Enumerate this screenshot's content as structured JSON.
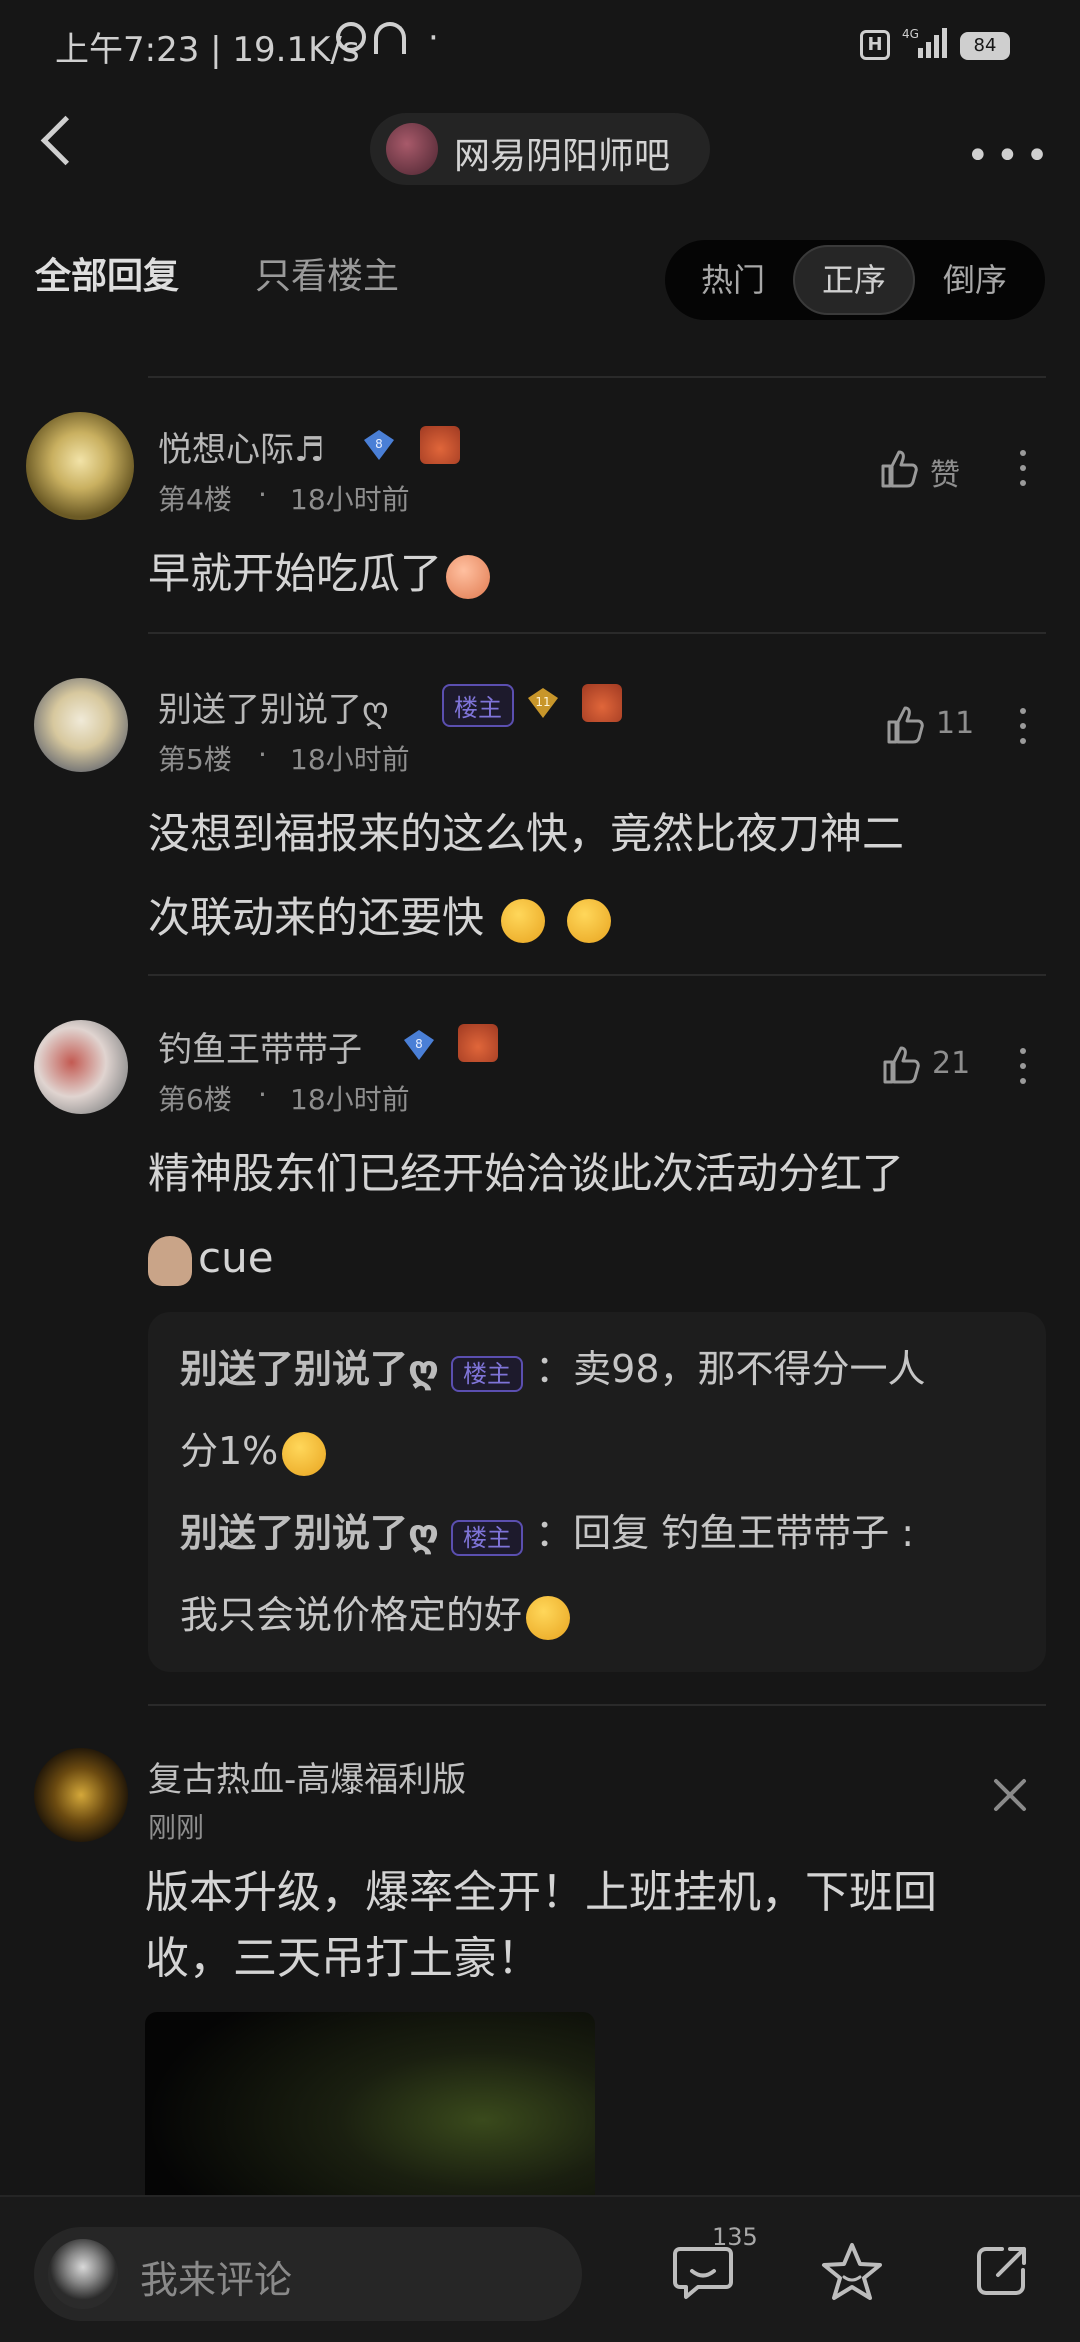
{
  "status_bar": {
    "time_speed": "上午7:23 | 19.1K/s",
    "dot": "·",
    "network": "4G",
    "battery": "84"
  },
  "nav": {
    "forum_name": "网易阴阳师吧"
  },
  "tabs": {
    "all_replies": "全部回复",
    "only_op": "只看楼主",
    "sort": [
      "热门",
      "正序",
      "倒序"
    ],
    "sort_selected": "正序"
  },
  "posts": [
    {
      "username": "悦想心际♬",
      "level": "8",
      "floor": "第4楼",
      "separator": "·",
      "time": "18小时前",
      "like_label": "赞",
      "content": "早就开始吃瓜了"
    },
    {
      "username": "别送了别说了ღ",
      "op_badge": "楼主",
      "level": "11",
      "floor": "第5楼",
      "separator": "·",
      "time": "18小时前",
      "likes": "11",
      "content_line1": "没想到福报来的这么快，竟然比夜刀神二",
      "content_line2": "次联动来的还要快"
    },
    {
      "username": "钓鱼王带带子",
      "level": "8",
      "floor": "第6楼",
      "separator": "·",
      "time": "18小时前",
      "likes": "21",
      "content_line1": "精神股东们已经开始洽谈此次活动分红了",
      "content_line2": "cue",
      "replies": [
        {
          "name": "别送了别说了ღ",
          "badge": "楼主",
          "text_line1": "：卖98，那不得分一人",
          "text_line2": "分1%"
        },
        {
          "name": "别送了别说了ღ",
          "badge": "楼主",
          "text_line1": "：回复 钓鱼王带带子 :",
          "text_line2": "我只会说价格定的好"
        }
      ]
    }
  ],
  "ad": {
    "title": "复古热血-高爆福利版",
    "time": "刚刚",
    "body_line1": "版本升级，爆率全开！上班挂机，下班回",
    "body_line2": "收，三天吊打土豪！"
  },
  "bottom_bar": {
    "comment_placeholder": "我来评论",
    "comment_count": "135"
  },
  "colors": {
    "background": "#161616",
    "op_badge": "#7f74d8",
    "diamond_badge": "#4a7fd6",
    "gold_badge": "#c8962a"
  }
}
